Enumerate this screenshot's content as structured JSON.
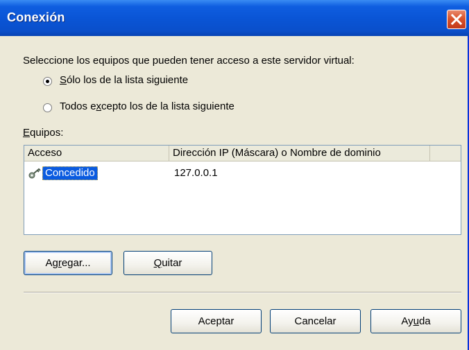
{
  "window": {
    "title": "Conexión",
    "close_icon": "close-icon"
  },
  "prompt": "Seleccione los equipos que pueden tener acceso a este servidor virtual:",
  "radios": [
    {
      "label": "Sólo los de la lista siguiente",
      "accel": "S",
      "rest": "ólo los de la lista siguiente",
      "checked": true
    },
    {
      "label": "Todos excepto los de la lista siguiente",
      "pre": "Todos e",
      "accel": "x",
      "rest": "cepto los de la lista siguiente",
      "checked": false
    }
  ],
  "equipos_label": {
    "accel": "E",
    "rest": "quipos:"
  },
  "list": {
    "columns": [
      "Acceso",
      "Dirección IP (Máscara) o Nombre de dominio"
    ],
    "rows": [
      {
        "acceso": "Concedido",
        "direccion": "127.0.0.1",
        "icon": "key-icon",
        "selected": true
      }
    ]
  },
  "buttons": {
    "agregar": {
      "pre": "Ag",
      "accel": "r",
      "rest": "egar..."
    },
    "quitar": {
      "accel": "Q",
      "rest": "uitar"
    },
    "aceptar": "Aceptar",
    "cancelar": "Cancelar",
    "ayuda": {
      "pre": "Ay",
      "accel": "u",
      "rest": "da"
    }
  },
  "colors": {
    "titlebar": "#0a55d6",
    "face": "#ece9d8",
    "selection": "#0a5be0",
    "close": "#d9542c"
  }
}
